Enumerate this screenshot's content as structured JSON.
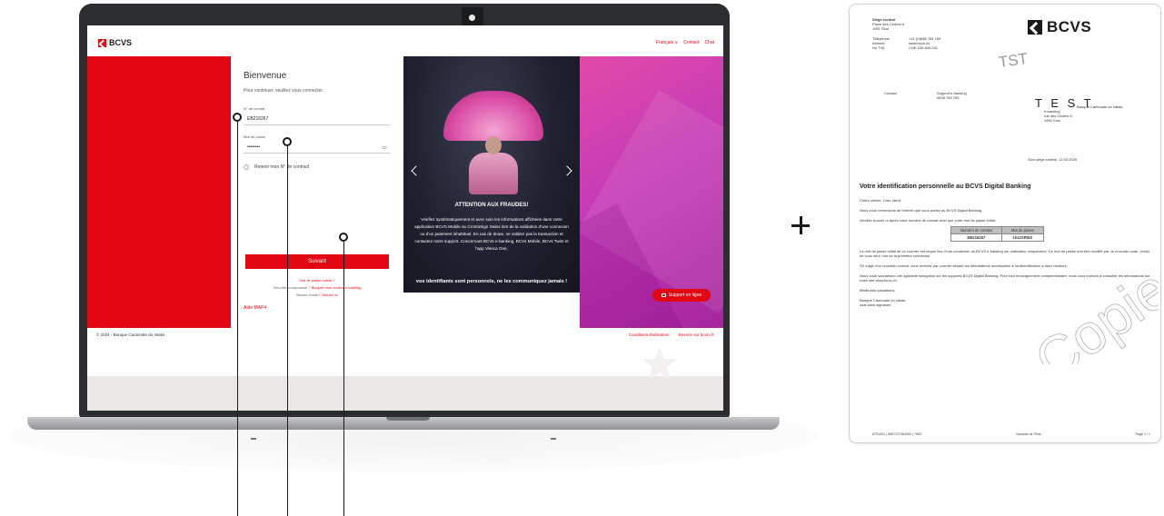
{
  "screen": {
    "logo_text": "BCVS",
    "top_links": [
      "Français ∨",
      "Contact",
      "Chat"
    ],
    "login": {
      "title": "Bienvenue",
      "subtitle": "Pour continuer, veuillez vous connecter.",
      "contract_label": "N° de contrat",
      "contract_value": "EB216267",
      "password_label": "Mot de passe",
      "password_value": "••••••••",
      "remember_label": "Retenir mon N° de contract",
      "submit_label": "Suivant",
      "forgot_password": "Mot de passe oublié ?",
      "security_prefix": "Sécurité compromise ?",
      "security_link": "Bloquer mon contrat e-banking",
      "help_prefix": "Besoin d'aide?",
      "help_link": "Cliquez ici"
    },
    "promo": {
      "title": "ATTENTION AUX FRAUDES!",
      "line1": "Vérifiez systématiquement et avec soin les informations affichées dans votre application BCVS Mobile ou CrontoSign Swiss lors de la validation d'une connexion ou d'un paiement inhabituel.",
      "line2": "En cas de doute, ne validez pas la transaction et contactez notre support.",
      "line3": "Concernant BCVs e-banking, BCVs Mobile, BCVs Twint et l'app Viseca One,",
      "line4": "vos identifiants sont personnels, ne les communiquez jamais !",
      "dots": 4,
      "active_dot": 0
    },
    "help_bar": "Aide MAP4",
    "support_button": "Support en ligne",
    "footer_left": "© 2024 - Banque Cantonale du Valais",
    "footer_links": [
      "Conditions d'utilisation",
      "Revenir sur bcvs.ch"
    ]
  },
  "letter": {
    "header_title": "Siège central",
    "header_lines": [
      "Place des Cèdres 8",
      "1951 Sion"
    ],
    "contact_rows": [
      [
        "Téléphone",
        "+41 (0)848 765 765"
      ],
      [
        "Internet",
        "www.bcvs.ch"
      ],
      [
        "No TVA",
        "CHE-105.845.241"
      ]
    ],
    "logo_text": "BCVS",
    "watermark_tst": "TST",
    "contact_label": "Contact",
    "contact_value1": "Support e-banking",
    "contact_value2": "0848 765 765",
    "test_mark": "T E S T",
    "address_lines": [
      "Banque Cantonale du Valais",
      "e-banking",
      "rue des Cèdres 8",
      "1950 Sion"
    ],
    "date_line": "Sion siège central, 12.03.2026",
    "title": "Votre identification personnelle au BCVS Digital Banking",
    "greeting": "Chère cliente, Cher client,",
    "p1": "Nous vous remercions de l'intérêt que vous portez au BCVS Digital Banking.",
    "p2": "Veuillez trouver ci-après votre numéro de contrat ainsi que votre mot de passe initial:",
    "table_headers": [
      "Numéro de contrat",
      "Mot de passe"
    ],
    "table_values": [
      "EB216267",
      "1b12SRWZ"
    ],
    "p3": "Le mot de passe initial de ce courrier est requis lors d'une connexion au BCVS e-banking sur ordinateur uniquement. Ce mot de passe doit être modifié par un nouveau code, choisi de vous seul, lors de la première connexion.",
    "p4": "S'il s'agit d'un nouveau contrat, vous recevez par courrier séparé les informations nécessaires à l'authentification à deux facteurs.",
    "p5": "Nous vous souhaitons une agréable navigation sur les supports BCVS Digital Banking. Pour tout renseignement complémentaire, nous vous invitons à consulter les informations sur notre site www.bcvs.ch.",
    "closing": "Meilleures salutations",
    "signature1": "Banque Cantonale du Valais",
    "signature2": "Avis sans signature",
    "watermark_copie": "Copie",
    "footer_left": "8701001 | 8897107484290 | 7850",
    "footer_center": "Garantie de l'Etat",
    "footer_right": "Page 1 / 1"
  },
  "colors": {
    "brand_red": "#e30613",
    "promo_pink": "#c53bb7",
    "laptop_dark": "#2c2d30"
  }
}
